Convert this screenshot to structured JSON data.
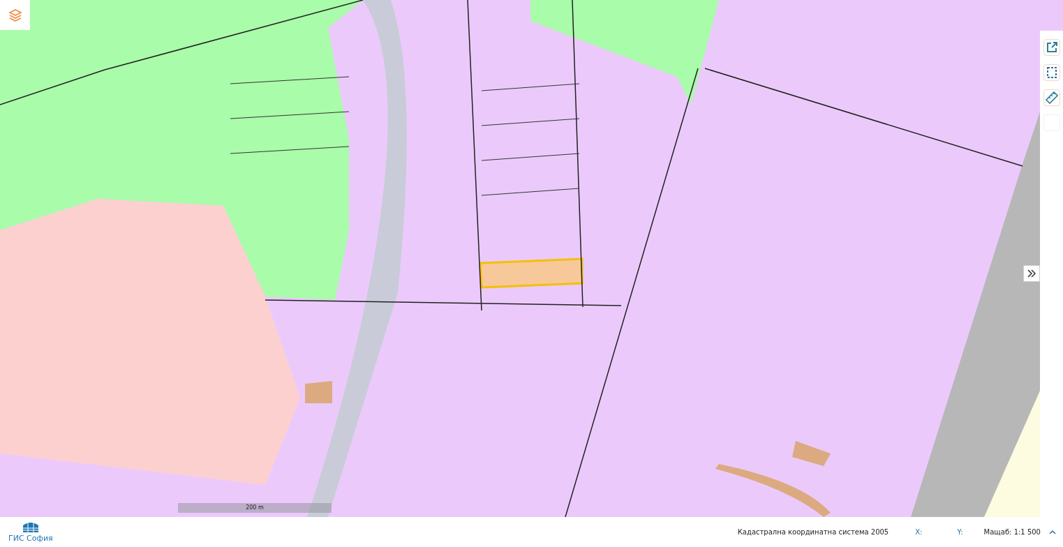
{
  "map": {
    "kind": "picture",
    "scale_bar": "200 m"
  },
  "toolbar": {
    "tools": [
      {
        "kind": "open-external"
      },
      {
        "kind": "select-area"
      },
      {
        "kind": "measure"
      },
      {
        "kind": "blank"
      }
    ]
  },
  "status_bar": {
    "logo_text": "ГИС София",
    "coordinate_system": "Кадастрална координатна система 2005",
    "x_label": "X:",
    "y_label": "Y:",
    "scale": "Мащаб: 1:1 500"
  }
}
